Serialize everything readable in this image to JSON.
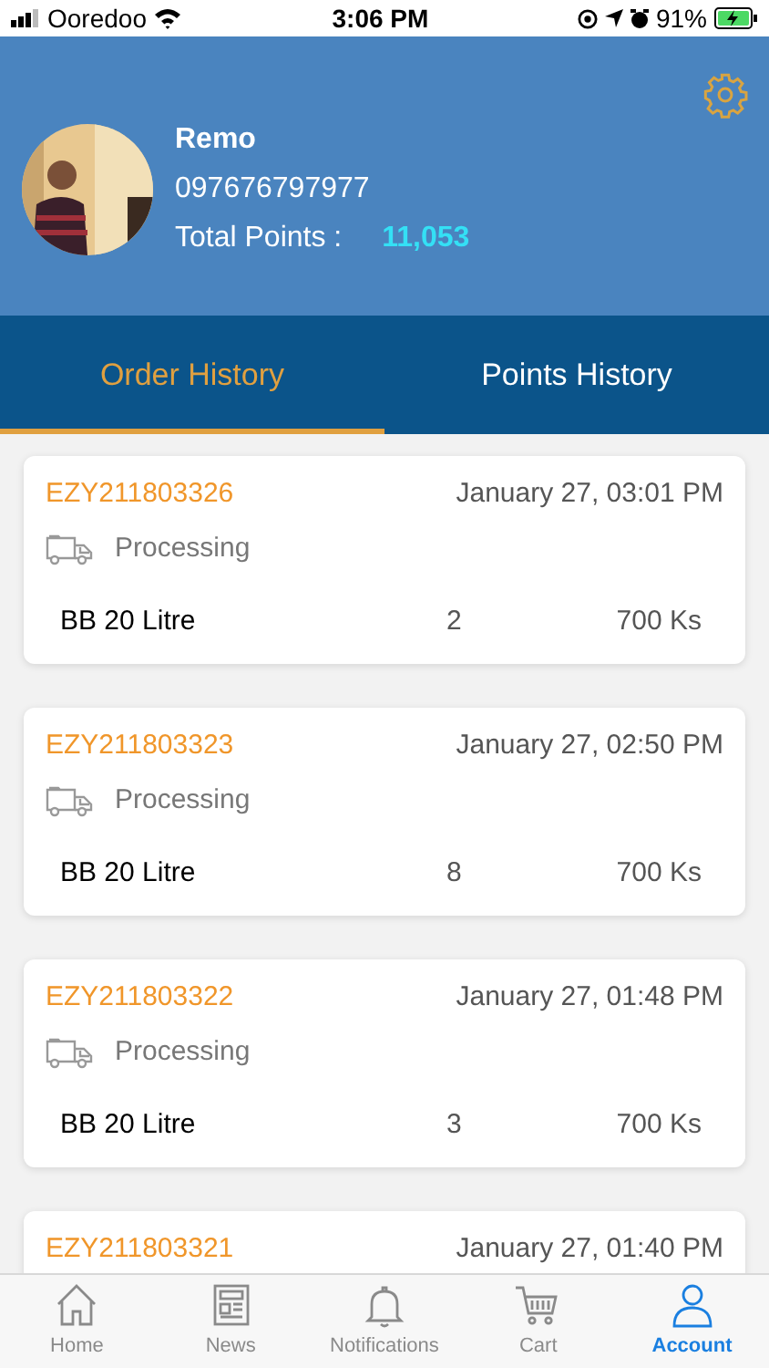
{
  "status_bar": {
    "carrier": "Ooredoo",
    "time": "3:06 PM",
    "battery": "91%"
  },
  "profile": {
    "name": "Remo",
    "phone": "097676797977",
    "points_label": "Total Points :",
    "points": "11,053"
  },
  "tabs": [
    {
      "label": "Order History",
      "selected": true
    },
    {
      "label": "Points History",
      "selected": false
    }
  ],
  "orders": [
    {
      "id": "EZY211803326",
      "date": "January 27, 03:01 PM",
      "status": "Processing",
      "item": "BB 20 Litre",
      "qty": "2",
      "price": "700 Ks"
    },
    {
      "id": "EZY211803323",
      "date": "January 27, 02:50 PM",
      "status": "Processing",
      "item": "BB 20 Litre",
      "qty": "8",
      "price": "700 Ks"
    },
    {
      "id": "EZY211803322",
      "date": "January 27, 01:48 PM",
      "status": "Processing",
      "item": "BB 20 Litre",
      "qty": "3",
      "price": "700 Ks"
    },
    {
      "id": "EZY211803321",
      "date": "January 27, 01:40 PM"
    }
  ],
  "tab_bar": [
    {
      "kind": "home",
      "label": "Home",
      "selected": false
    },
    {
      "kind": "news",
      "label": "News",
      "selected": false
    },
    {
      "kind": "bell",
      "label": "Notifications",
      "selected": false
    },
    {
      "kind": "cart",
      "label": "Cart",
      "selected": false
    },
    {
      "kind": "person",
      "label": "Account",
      "selected": true
    }
  ]
}
